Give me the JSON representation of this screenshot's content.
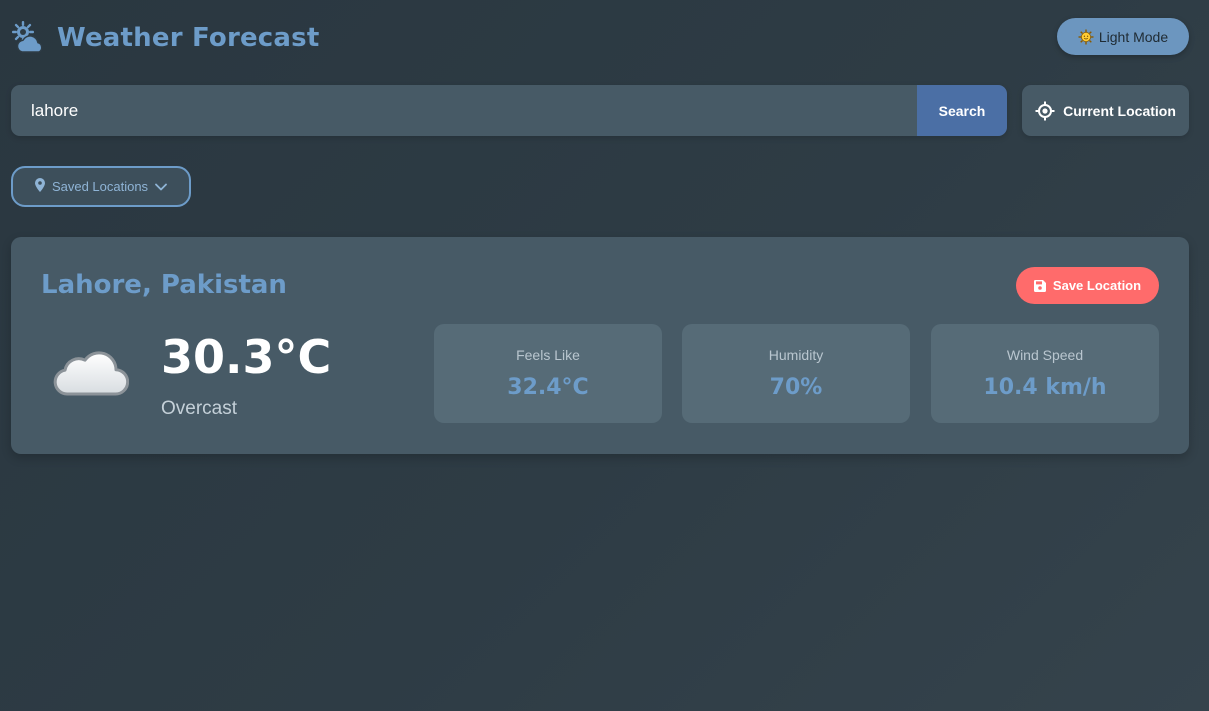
{
  "header": {
    "title": "Weather Forecast",
    "app_icon": "sun-behind-cloud-icon",
    "theme_toggle_label": "Light Mode",
    "theme_toggle_icon": "sun-icon"
  },
  "search": {
    "value": "lahore",
    "button_label": "Search",
    "current_location_label": "Current Location",
    "current_location_icon": "crosshair-icon"
  },
  "saved_locations": {
    "label": "Saved Locations",
    "icon": "map-pin-icon",
    "chevron": "chevron-down-icon"
  },
  "weather": {
    "city": "Lahore, Pakistan",
    "save_label": "Save Location",
    "save_icon": "floppy-disk-icon",
    "temperature": "30.3°C",
    "condition": "Overcast",
    "condition_icon": "cloud-icon",
    "stats": {
      "feels_like": {
        "label": "Feels Like",
        "value": "32.4°C"
      },
      "humidity": {
        "label": "Humidity",
        "value": "70%"
      },
      "wind_speed": {
        "label": "Wind Speed",
        "value": "10.4 km/h"
      }
    }
  },
  "colors": {
    "accent": "#6d9cc9",
    "search_button": "#4b6fa5",
    "save_button": "#ff6b6b",
    "card_background": "#475a66",
    "stat_background": "#566b77"
  }
}
